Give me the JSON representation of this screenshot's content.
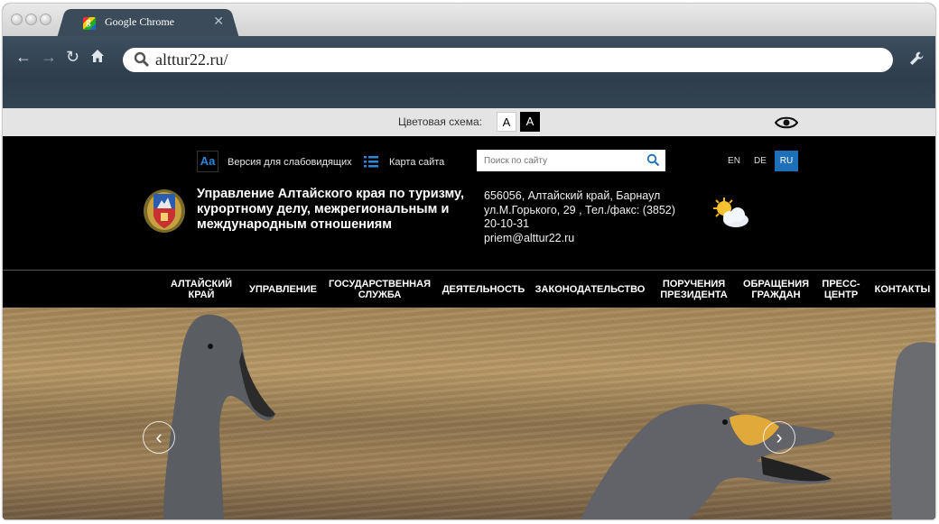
{
  "browser": {
    "tab_title": "Google Chrome",
    "favicon_letter": "g",
    "url": "alttur22.ru/"
  },
  "scheme": {
    "label": "Цветовая схема:",
    "white_option": "A",
    "black_option": "A"
  },
  "top_links": {
    "low_vision": "Версия для слабовидящих",
    "sitemap": "Карта сайта",
    "aa_glyph": "Aa"
  },
  "search": {
    "placeholder": "Поиск по сайту"
  },
  "languages": [
    {
      "code": "EN",
      "active": false
    },
    {
      "code": "DE",
      "active": false
    },
    {
      "code": "RU",
      "active": true
    }
  ],
  "header": {
    "org_name": "Управление Алтайского края по туризму, курортному делу, межрегиональным и международным отношениям",
    "address_line1": "656056, Алтайский край, Барнаул",
    "address_line2": "ул.М.Горького, 29 , Тел./факс: (3852)",
    "phone": "20-10-31",
    "email": "priem@alttur22.ru"
  },
  "menu": [
    "Алтайский край",
    "Управление",
    "Государственная служба",
    "Деятельность",
    "Законодательство",
    "Поручения Президента",
    "Обращения граждан",
    "Пресс-центр",
    "Контакты"
  ],
  "slider": {
    "prev": "‹",
    "next": "›"
  },
  "colors": {
    "accent": "#1d6fb8",
    "page_bg": "#000000",
    "scheme_bar": "#e4e4e4"
  }
}
